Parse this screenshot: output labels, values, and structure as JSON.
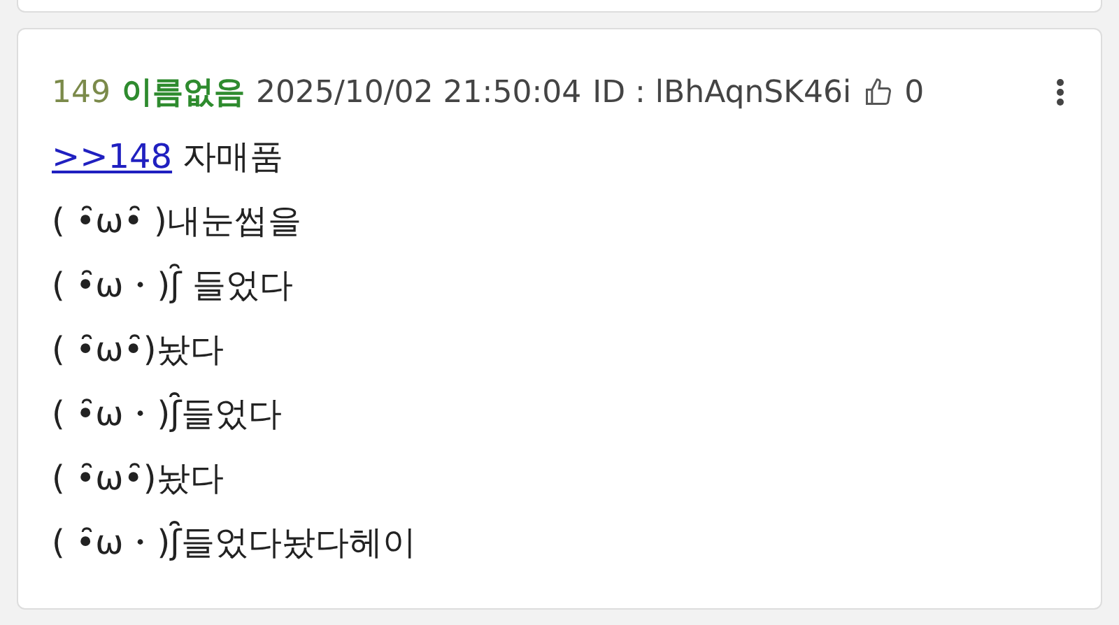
{
  "post": {
    "number": "149",
    "author": "이름없음",
    "datetime": "2025/10/02 21:50:04",
    "id_label": "ID : lBhAqnSK46i",
    "likes": "0",
    "reply_link": ">>148",
    "lines": [
      "자매품",
      "( •̑ω•̑ )내눈썹을",
      "(  •̑ω・)ʃ̑ 들었다",
      "( •̑ω•̑)놨다",
      "(  •̑ω・)ʃ̑̑들었다",
      "(  •̑ω•̑)놨다",
      "(  •̑ω・)ʃ̑̑들었다놨다헤이"
    ]
  }
}
